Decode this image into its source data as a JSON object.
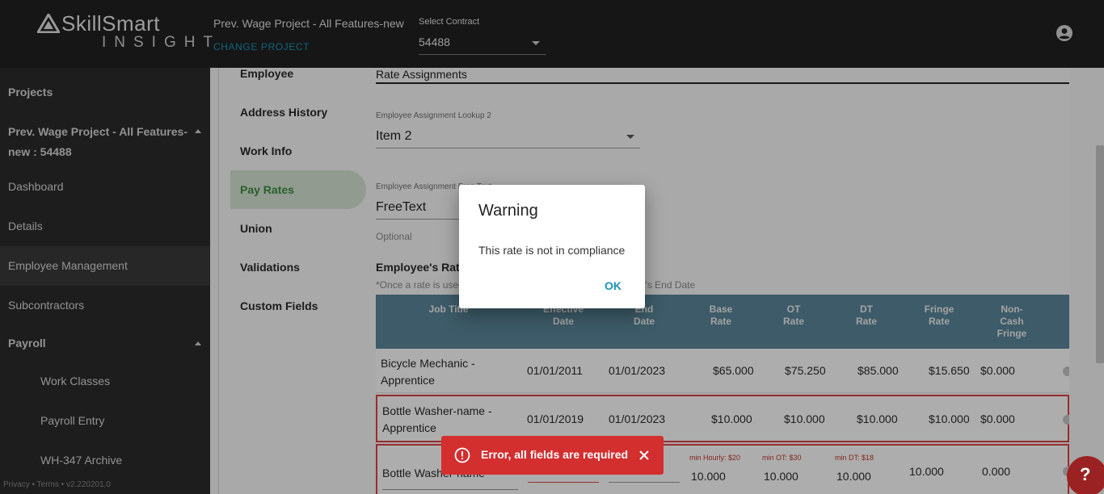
{
  "header": {
    "logo_top": "SkillSmart",
    "logo_bottom": "INSIGHT",
    "project_title": "Prev. Wage Project - All Features-new",
    "change_project": "CHANGE PROJECT",
    "contract_label": "Select Contract",
    "contract_value": "54488"
  },
  "sidebar": {
    "projects": "Projects",
    "project_line1": "Prev. Wage Project - All Features-",
    "project_line2": "new : 54488",
    "dashboard": "Dashboard",
    "details": "Details",
    "employee_management": "Employee Management",
    "subcontractors": "Subcontractors",
    "payroll": "Payroll",
    "work_classes": "Work Classes",
    "payroll_entry": "Payroll Entry",
    "wh347": "WH-347 Archive",
    "footer": "Privacy • Terms • v2.220201.0"
  },
  "subnav": {
    "employee": "Employee",
    "address_history": "Address History",
    "work_info": "Work Info",
    "pay_rates": "Pay Rates",
    "union": "Union",
    "validations": "Validations",
    "custom_fields": "Custom Fields"
  },
  "form": {
    "section_title": "Rate Assignments",
    "lookup_label": "Employee Assignment Lookup 2",
    "lookup_value": "Item 2",
    "freetext_label": "Employee Assignment Free Text",
    "freetext_value": "FreeText",
    "optional": "Optional",
    "rates_title": "Employee's Rates",
    "rates_note": "*Once a rate is used on a payroll, you will only be able to edit it's End Date"
  },
  "table": {
    "headers": {
      "job_title": "Job Title",
      "effective_date": [
        "Effective",
        "Date"
      ],
      "end_date": [
        "End",
        "Date"
      ],
      "base_rate": [
        "Base",
        "Rate"
      ],
      "ot_rate": [
        "OT",
        "Rate"
      ],
      "dt_rate": [
        "DT",
        "Rate"
      ],
      "fringe_rate": [
        "Fringe",
        "Rate"
      ],
      "non_cash_fringe": [
        "Non-",
        "Cash",
        "Fringe"
      ]
    },
    "rows": [
      {
        "job_line1": "Bicycle Mechanic -",
        "job_line2": "Apprentice",
        "effective": "01/01/2011",
        "end": "01/01/2023",
        "base": "$65.000",
        "ot": "$75.250",
        "dt": "$85.000",
        "fringe": "$15.650",
        "noncash": "$0.000"
      },
      {
        "job_line1": "Bottle Washer-name -",
        "job_line2": "Apprentice",
        "effective": "01/01/2019",
        "end": "01/01/2023",
        "base": "$10.000",
        "ot": "$10.000",
        "dt": "$10.000",
        "fringe": "$10.000",
        "noncash": "$0.000"
      }
    ],
    "edit_row": {
      "job": "Bottle Washer-name -",
      "min_hourly": "min Hourly: $20",
      "min_ot": "min OT: $30",
      "min_dt": "min DT: $18",
      "base": "10.000",
      "ot": "10.000",
      "dt": "10.000",
      "fringe": "10.000",
      "noncash": "0.000"
    }
  },
  "dialog": {
    "title": "Warning",
    "message": "This rate is not in compliance",
    "ok": "OK"
  },
  "snackbar": {
    "message": "Error, all fields are required"
  },
  "help": {
    "label": "?"
  },
  "colors": {
    "accent": "#1b93b5",
    "header": "#5b879a",
    "error": "#d32f2f",
    "active_nav": "#3e8e41"
  }
}
